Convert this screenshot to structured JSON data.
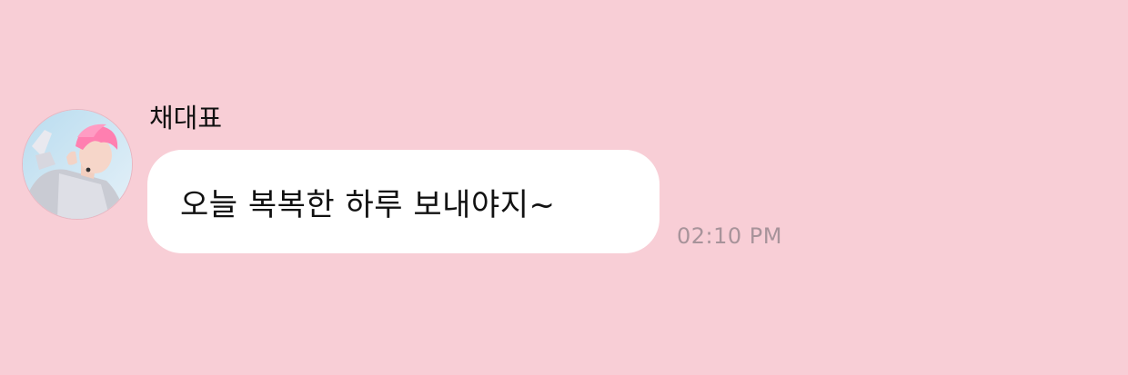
{
  "message": {
    "sender_name": "채대표",
    "avatar_icon": "profile-photo-pink-hair-person",
    "text": "오늘 복복한 하루 보내야지~",
    "timestamp": "02:10 PM"
  },
  "colors": {
    "background": "#f8ced6",
    "bubble": "#ffffff",
    "text": "#111111",
    "timestamp": "#a7939a"
  }
}
